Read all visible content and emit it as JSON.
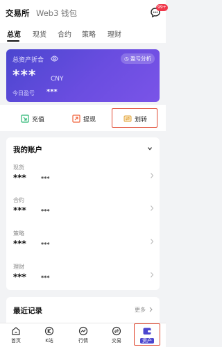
{
  "header": {
    "tab_exchange": "交易所",
    "tab_web3": "Web3 钱包",
    "message_badge": "99+"
  },
  "tabs": [
    "总览",
    "现货",
    "合约",
    "策略",
    "理财"
  ],
  "asset_card": {
    "title": "总资产折合",
    "pnl_button": "盈亏分析",
    "amount": "***",
    "currency": "CNY",
    "today_pnl_label": "今日盈亏",
    "today_pnl_value": "***"
  },
  "actions": {
    "deposit": "充值",
    "withdraw": "提现",
    "transfer": "划转"
  },
  "accounts": {
    "title": "我的账户",
    "items": [
      {
        "name": "现货",
        "value": "***",
        "sub": "***"
      },
      {
        "name": "合约",
        "value": "***",
        "sub": "***"
      },
      {
        "name": "策略",
        "value": "***",
        "sub": "***"
      },
      {
        "name": "理财",
        "value": "***",
        "sub": "***"
      }
    ]
  },
  "recent": {
    "title": "最近记录",
    "more": "更多"
  },
  "bottom_nav": [
    "首页",
    "K站",
    "行情",
    "交易",
    "资产"
  ],
  "colors": {
    "accent": "#4b46cf",
    "highlight": "#e0472f"
  }
}
